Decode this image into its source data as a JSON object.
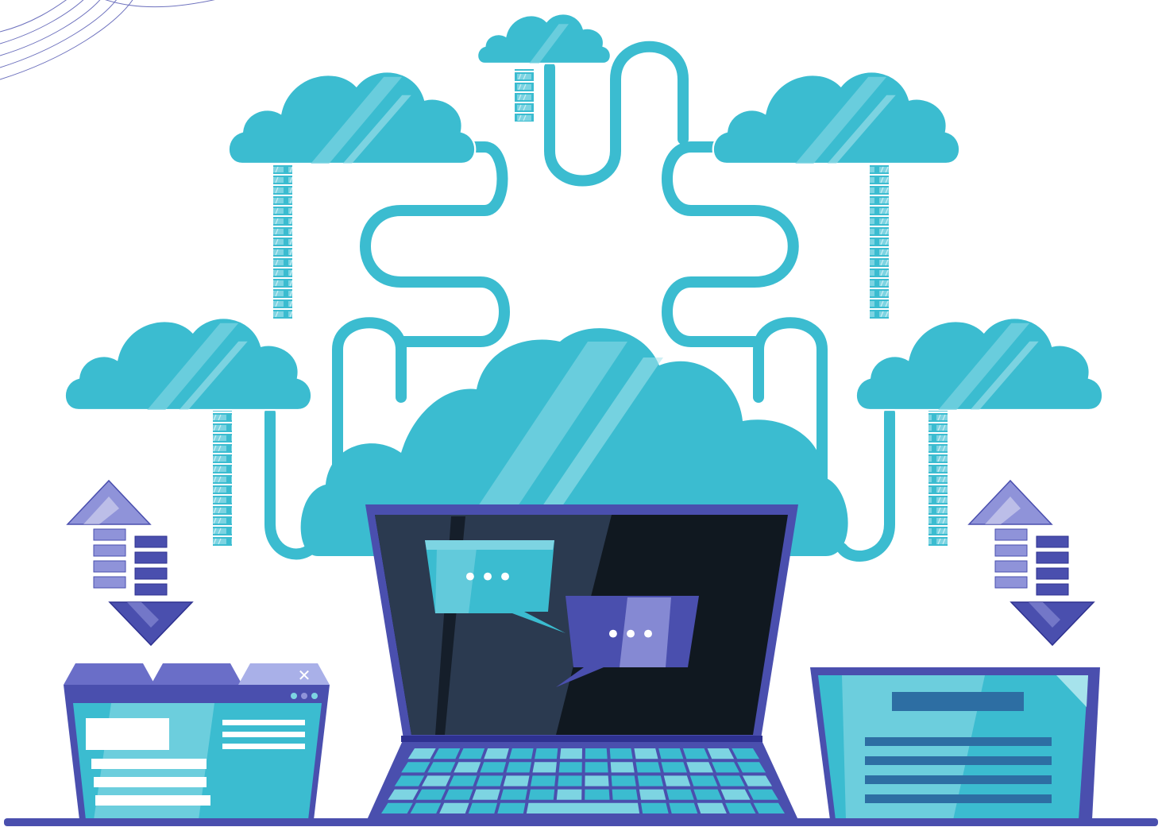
{
  "scene": {
    "colors": {
      "cyan": "#3bbcd0",
      "cyan_light": "#7dd4e2",
      "cyan_pale": "#a6e3ec",
      "purple": "#4a4fae",
      "purple_mid": "#6a6ec8",
      "purple_light": "#8f93d9",
      "screen_dark": "#101820",
      "screen_slate": "#2b3a50",
      "white": "#ffffff",
      "navy_bar": "#2d6ea3"
    },
    "icons": [
      "cloud-icon",
      "server-stack-icon",
      "upload-arrow-icon",
      "download-arrow-icon",
      "chat-bubble-icon",
      "close-icon",
      "laptop-icon",
      "browser-window-icon",
      "document-icon"
    ],
    "close_glyph": "✕",
    "chat_dots": "•••"
  }
}
